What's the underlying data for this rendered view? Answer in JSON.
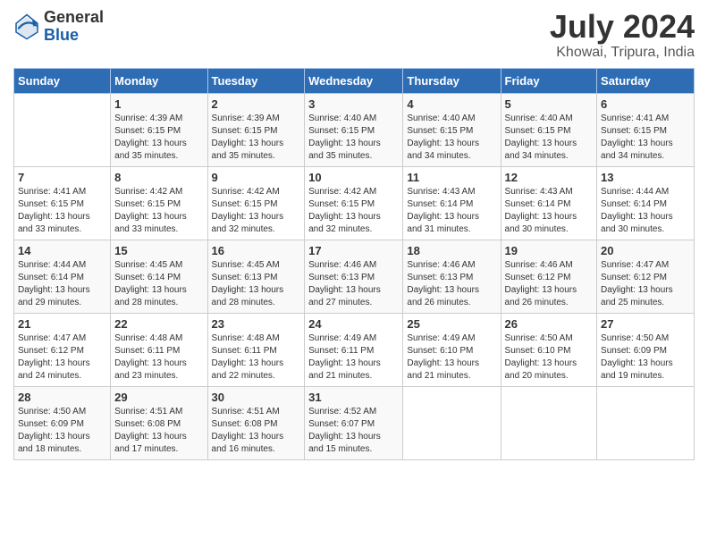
{
  "header": {
    "logo_line1": "General",
    "logo_line2": "Blue",
    "month_year": "July 2024",
    "location": "Khowai, Tripura, India"
  },
  "days_of_week": [
    "Sunday",
    "Monday",
    "Tuesday",
    "Wednesday",
    "Thursday",
    "Friday",
    "Saturday"
  ],
  "weeks": [
    [
      {
        "day": "",
        "sunrise": "",
        "sunset": "",
        "daylight": ""
      },
      {
        "day": "1",
        "sunrise": "4:39 AM",
        "sunset": "6:15 PM",
        "daylight": "13 hours and 35 minutes."
      },
      {
        "day": "2",
        "sunrise": "4:39 AM",
        "sunset": "6:15 PM",
        "daylight": "13 hours and 35 minutes."
      },
      {
        "day": "3",
        "sunrise": "4:40 AM",
        "sunset": "6:15 PM",
        "daylight": "13 hours and 35 minutes."
      },
      {
        "day": "4",
        "sunrise": "4:40 AM",
        "sunset": "6:15 PM",
        "daylight": "13 hours and 34 minutes."
      },
      {
        "day": "5",
        "sunrise": "4:40 AM",
        "sunset": "6:15 PM",
        "daylight": "13 hours and 34 minutes."
      },
      {
        "day": "6",
        "sunrise": "4:41 AM",
        "sunset": "6:15 PM",
        "daylight": "13 hours and 34 minutes."
      }
    ],
    [
      {
        "day": "7",
        "sunrise": "4:41 AM",
        "sunset": "6:15 PM",
        "daylight": "13 hours and 33 minutes."
      },
      {
        "day": "8",
        "sunrise": "4:42 AM",
        "sunset": "6:15 PM",
        "daylight": "13 hours and 33 minutes."
      },
      {
        "day": "9",
        "sunrise": "4:42 AM",
        "sunset": "6:15 PM",
        "daylight": "13 hours and 32 minutes."
      },
      {
        "day": "10",
        "sunrise": "4:42 AM",
        "sunset": "6:15 PM",
        "daylight": "13 hours and 32 minutes."
      },
      {
        "day": "11",
        "sunrise": "4:43 AM",
        "sunset": "6:14 PM",
        "daylight": "13 hours and 31 minutes."
      },
      {
        "day": "12",
        "sunrise": "4:43 AM",
        "sunset": "6:14 PM",
        "daylight": "13 hours and 30 minutes."
      },
      {
        "day": "13",
        "sunrise": "4:44 AM",
        "sunset": "6:14 PM",
        "daylight": "13 hours and 30 minutes."
      }
    ],
    [
      {
        "day": "14",
        "sunrise": "4:44 AM",
        "sunset": "6:14 PM",
        "daylight": "13 hours and 29 minutes."
      },
      {
        "day": "15",
        "sunrise": "4:45 AM",
        "sunset": "6:14 PM",
        "daylight": "13 hours and 28 minutes."
      },
      {
        "day": "16",
        "sunrise": "4:45 AM",
        "sunset": "6:13 PM",
        "daylight": "13 hours and 28 minutes."
      },
      {
        "day": "17",
        "sunrise": "4:46 AM",
        "sunset": "6:13 PM",
        "daylight": "13 hours and 27 minutes."
      },
      {
        "day": "18",
        "sunrise": "4:46 AM",
        "sunset": "6:13 PM",
        "daylight": "13 hours and 26 minutes."
      },
      {
        "day": "19",
        "sunrise": "4:46 AM",
        "sunset": "6:12 PM",
        "daylight": "13 hours and 26 minutes."
      },
      {
        "day": "20",
        "sunrise": "4:47 AM",
        "sunset": "6:12 PM",
        "daylight": "13 hours and 25 minutes."
      }
    ],
    [
      {
        "day": "21",
        "sunrise": "4:47 AM",
        "sunset": "6:12 PM",
        "daylight": "13 hours and 24 minutes."
      },
      {
        "day": "22",
        "sunrise": "4:48 AM",
        "sunset": "6:11 PM",
        "daylight": "13 hours and 23 minutes."
      },
      {
        "day": "23",
        "sunrise": "4:48 AM",
        "sunset": "6:11 PM",
        "daylight": "13 hours and 22 minutes."
      },
      {
        "day": "24",
        "sunrise": "4:49 AM",
        "sunset": "6:11 PM",
        "daylight": "13 hours and 21 minutes."
      },
      {
        "day": "25",
        "sunrise": "4:49 AM",
        "sunset": "6:10 PM",
        "daylight": "13 hours and 21 minutes."
      },
      {
        "day": "26",
        "sunrise": "4:50 AM",
        "sunset": "6:10 PM",
        "daylight": "13 hours and 20 minutes."
      },
      {
        "day": "27",
        "sunrise": "4:50 AM",
        "sunset": "6:09 PM",
        "daylight": "13 hours and 19 minutes."
      }
    ],
    [
      {
        "day": "28",
        "sunrise": "4:50 AM",
        "sunset": "6:09 PM",
        "daylight": "13 hours and 18 minutes."
      },
      {
        "day": "29",
        "sunrise": "4:51 AM",
        "sunset": "6:08 PM",
        "daylight": "13 hours and 17 minutes."
      },
      {
        "day": "30",
        "sunrise": "4:51 AM",
        "sunset": "6:08 PM",
        "daylight": "13 hours and 16 minutes."
      },
      {
        "day": "31",
        "sunrise": "4:52 AM",
        "sunset": "6:07 PM",
        "daylight": "13 hours and 15 minutes."
      },
      {
        "day": "",
        "sunrise": "",
        "sunset": "",
        "daylight": ""
      },
      {
        "day": "",
        "sunrise": "",
        "sunset": "",
        "daylight": ""
      },
      {
        "day": "",
        "sunrise": "",
        "sunset": "",
        "daylight": ""
      }
    ]
  ],
  "labels": {
    "sunrise_prefix": "Sunrise: ",
    "sunset_prefix": "Sunset: ",
    "daylight_prefix": "Daylight: "
  }
}
